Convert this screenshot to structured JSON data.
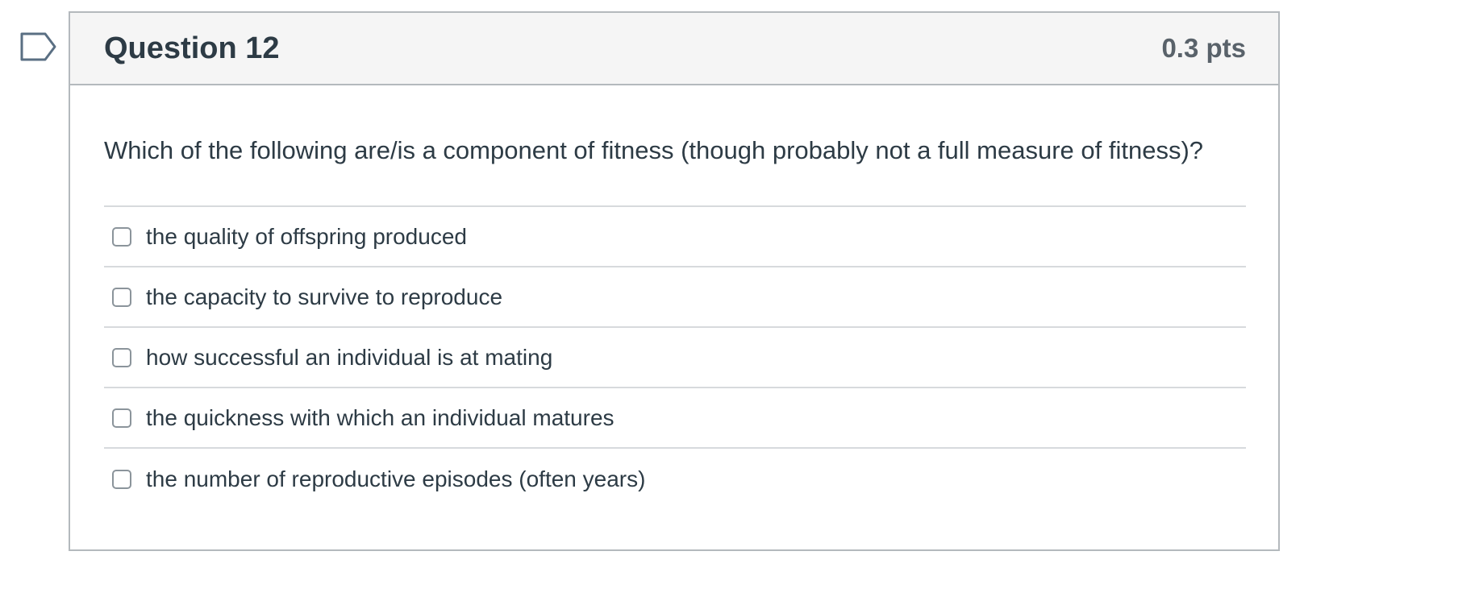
{
  "flag": {
    "icon": "flag-outline-icon",
    "color": "#5a6f83"
  },
  "question": {
    "title": "Question 12",
    "points": "0.3 pts",
    "text": "Which of the following are/is a component of fitness (though probably not a full measure of fitness)?",
    "answers": [
      {
        "label": "the quality of offspring produced",
        "checked": false
      },
      {
        "label": "the capacity to survive to reproduce",
        "checked": false
      },
      {
        "label": "how successful an individual is at mating",
        "checked": false
      },
      {
        "label": "the quickness with which an individual matures",
        "checked": false
      },
      {
        "label": "the number of reproductive episodes (often years)",
        "checked": false
      }
    ]
  },
  "colors": {
    "header_bg": "#f5f5f5",
    "border": "#b4b9bd",
    "text": "#2d3b45",
    "points_text": "#59626a"
  }
}
